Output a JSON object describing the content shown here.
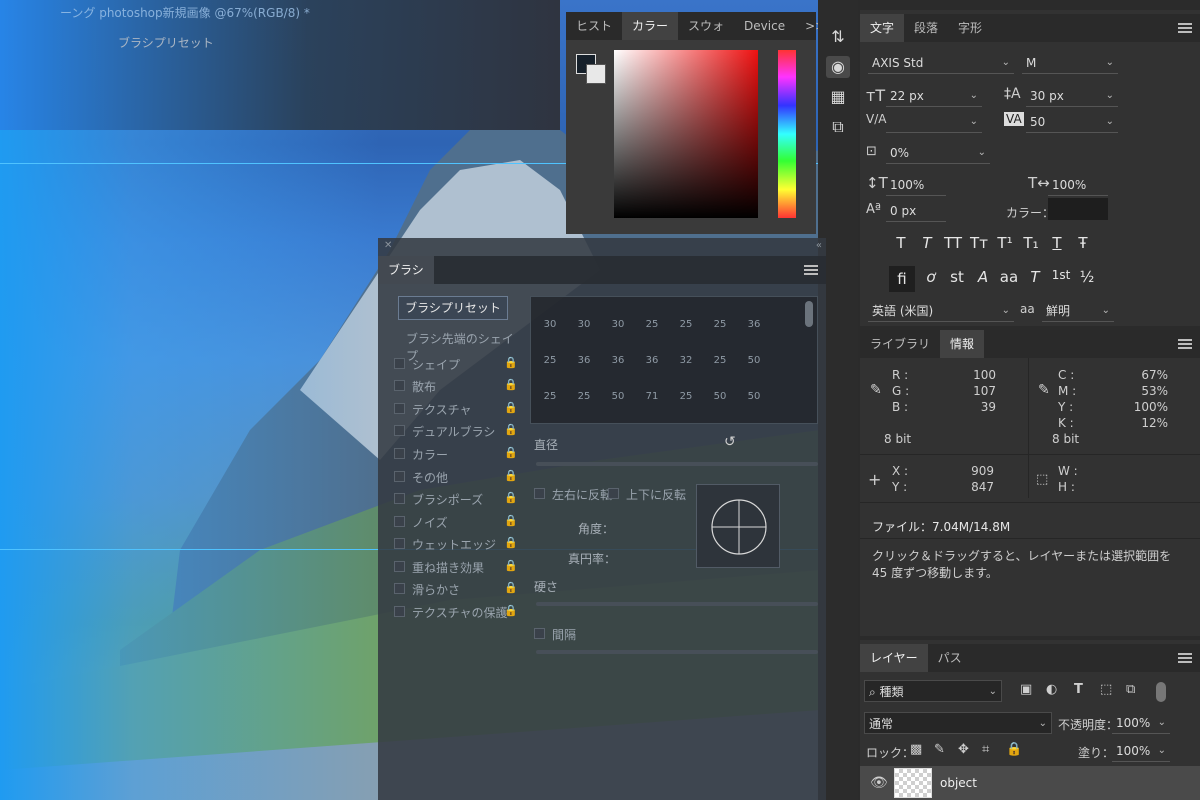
{
  "canvas": {
    "doc_title": "ーング photoshop新規画像 @67%(RGB/8) *",
    "doc_tab": "ブラシプリセット"
  },
  "color_panel": {
    "tabs": [
      "ヒスト",
      "カラー",
      "スウォ",
      "Device"
    ],
    "active_tab": "カラー",
    "overflow": ">>"
  },
  "character_panel": {
    "tabs": [
      "文字",
      "段落",
      "字形"
    ],
    "font_family": "AXIS Std",
    "font_style": "M",
    "font_size": "22 px",
    "leading": "30 px",
    "kerning": "",
    "tracking": "50",
    "tsume": "0%",
    "vertical_scale": "100%",
    "horizontal_scale": "100%",
    "baseline_shift": "0 px",
    "color_label": "カラー：",
    "language": "英語 (米国)",
    "antialias": "鮮明",
    "aa_label": "aa",
    "style_glyphs": [
      "T",
      "T",
      "TT",
      "Tт",
      "T¹",
      "T₁",
      "T",
      "Ŧ"
    ],
    "opentype_glyphs": [
      "fi",
      "ơ",
      "st",
      "A",
      "aa",
      "T",
      "1st",
      "½"
    ]
  },
  "library_info_panel": {
    "tabs": [
      "ライブラリ",
      "情報"
    ],
    "rgb": {
      "R": "100",
      "G": "107",
      "B": "39"
    },
    "cmyk": {
      "C": "67%",
      "M": "53%",
      "Y": "100%",
      "K": "12%"
    },
    "bit_left": "8 bit",
    "bit_right": "8 bit",
    "x": "909",
    "y": "847",
    "w": "",
    "h": "",
    "labels": {
      "R": "R :",
      "G": "G :",
      "B": "B :",
      "C": "C :",
      "M": "M :",
      "Y": "Y :",
      "K": "K :",
      "X": "X :",
      "Yc": "Y :",
      "W": "W :",
      "H": "H :"
    },
    "file_info": "ファイル：7.04M/14.8M",
    "hint": "クリック＆ドラッグすると、レイヤーまたは選択範囲を 45 度ずつ移動します。"
  },
  "layers_panel": {
    "tabs": [
      "レイヤー",
      "パス"
    ],
    "filter_kind": "種類",
    "blend_mode": "通常",
    "opacity_label": "不透明度：",
    "opacity": "100%",
    "lock_label": "ロック：",
    "fill_label": "塗り：",
    "fill": "100%",
    "layer_name": "object"
  },
  "brush_panel": {
    "tab": "ブラシ",
    "preset_button": "ブラシプリセット",
    "options": [
      "ブラシ先端のシェイプ",
      "シェイプ",
      "散布",
      "テクスチャ",
      "デュアルブラシ",
      "カラー",
      "その他",
      "ブラシポーズ",
      "ノイズ",
      "ウェットエッジ",
      "重ね描き効果",
      "滑らかさ",
      "テクスチャの保護"
    ],
    "sizes_row1": [
      "30",
      "30",
      "30",
      "25",
      "25",
      "25",
      "36"
    ],
    "sizes_row2": [
      "25",
      "36",
      "36",
      "36",
      "32",
      "25",
      "50"
    ],
    "sizes_row3": [
      "25",
      "25",
      "50",
      "71",
      "25",
      "50",
      "50"
    ],
    "diameter_label": "直径",
    "flip_x": "左右に反転",
    "flip_y": "上下に反転",
    "angle_label": "角度：",
    "roundness_label": "真円率：",
    "hardness_label": "硬さ",
    "spacing_label": "間隔"
  },
  "colors": {
    "panel_bg": "#323232",
    "dark_bg": "#2b2b2b",
    "guide": "#4fc3ff",
    "accent_blue": "#1f9bf1"
  }
}
